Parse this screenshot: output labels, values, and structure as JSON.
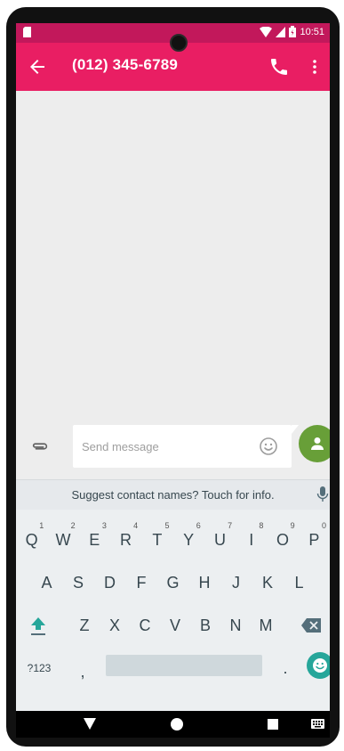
{
  "status_bar": {
    "time": "10:51",
    "icons": [
      "sim-card-icon",
      "wifi-icon",
      "signal-icon",
      "battery-icon"
    ]
  },
  "app_bar": {
    "title": "(012) 345-6789",
    "icons": [
      "back-arrow-icon",
      "phone-call-icon",
      "more-vert-icon"
    ]
  },
  "compose": {
    "placeholder": "Send message",
    "icons": [
      "attach-icon",
      "emoji-icon",
      "contact-icon"
    ]
  },
  "suggestion": {
    "text": "Suggest contact names? Touch for info."
  },
  "keyboard": {
    "row1": [
      {
        "label": "Q",
        "hint": "1"
      },
      {
        "label": "W",
        "hint": "2"
      },
      {
        "label": "E",
        "hint": "3"
      },
      {
        "label": "R",
        "hint": "4"
      },
      {
        "label": "T",
        "hint": "5"
      },
      {
        "label": "Y",
        "hint": "6"
      },
      {
        "label": "U",
        "hint": "7"
      },
      {
        "label": "I",
        "hint": "8"
      },
      {
        "label": "O",
        "hint": "9"
      },
      {
        "label": "P",
        "hint": "0"
      }
    ],
    "row2": [
      "A",
      "S",
      "D",
      "F",
      "G",
      "H",
      "J",
      "K",
      "L"
    ],
    "row3": [
      "Z",
      "X",
      "C",
      "V",
      "B",
      "N",
      "M"
    ],
    "symbols_label": "?123",
    "comma_label": ",",
    "period_label": "."
  },
  "colors": {
    "app_bar": "#e91e63",
    "status_bar": "#c2185b",
    "send_button": "#689f38",
    "emoji_key": "#26a69a",
    "shift_active": "#26a69a"
  }
}
